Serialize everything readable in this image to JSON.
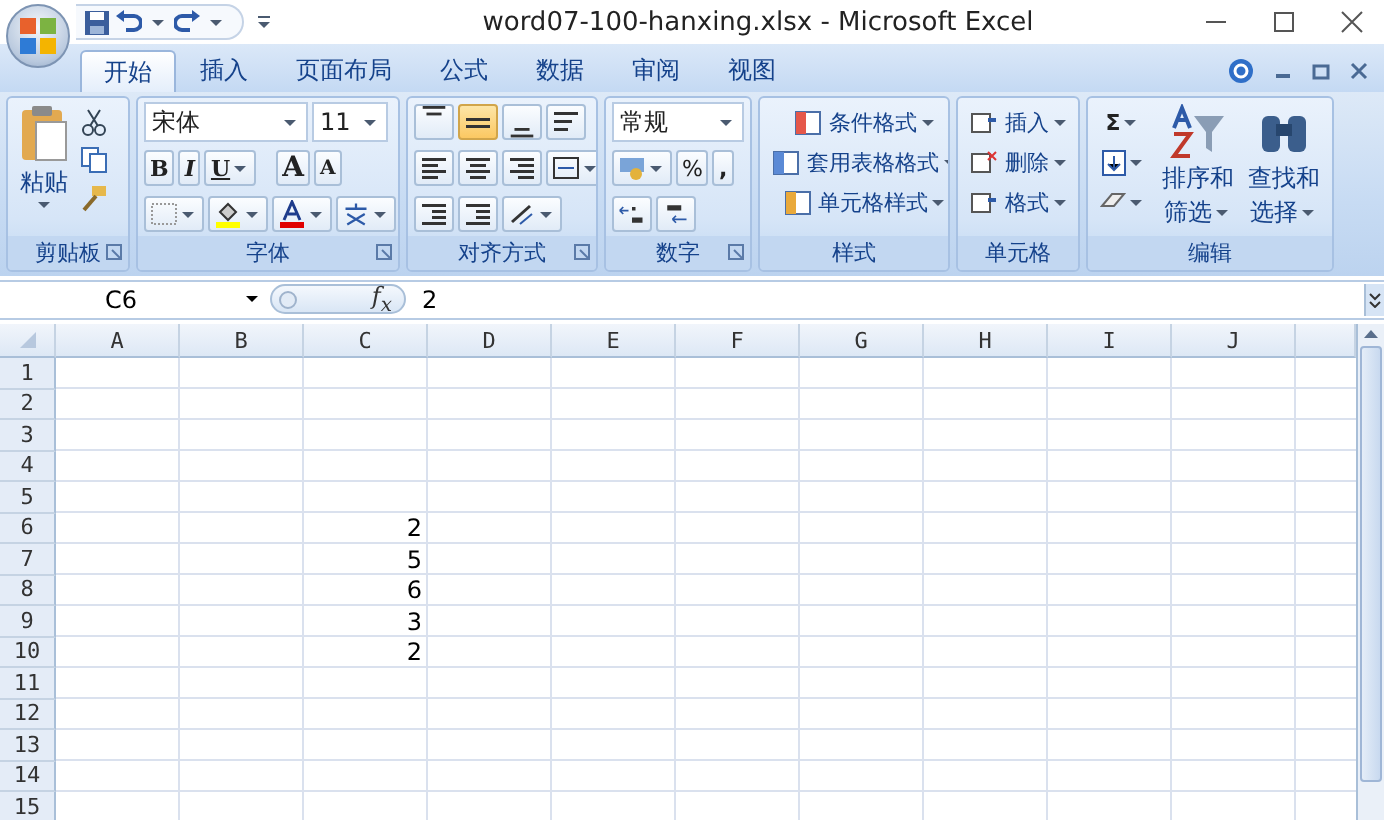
{
  "window": {
    "title": "word07-100-hanxing.xlsx - Microsoft Excel"
  },
  "tabs": [
    {
      "label": "开始",
      "selected": true
    },
    {
      "label": "插入",
      "selected": false
    },
    {
      "label": "页面布局",
      "selected": false
    },
    {
      "label": "公式",
      "selected": false
    },
    {
      "label": "数据",
      "selected": false
    },
    {
      "label": "审阅",
      "selected": false
    },
    {
      "label": "视图",
      "selected": false
    }
  ],
  "clipboard": {
    "paste": "粘贴",
    "label": "剪贴板"
  },
  "font": {
    "name": "宋体",
    "size": "11",
    "bold": "B",
    "italic": "I",
    "underline": "U",
    "grow": "A",
    "shrink": "A",
    "label": "字体"
  },
  "alignment": {
    "label": "对齐方式",
    "buttons": [
      {
        "kind": "top",
        "selected": false
      },
      {
        "kind": "middle",
        "selected": true
      },
      {
        "kind": "bottom",
        "selected": false
      },
      {
        "kind": "left",
        "selected": false
      },
      {
        "kind": "center",
        "selected": false
      },
      {
        "kind": "right",
        "selected": false
      }
    ]
  },
  "number": {
    "format": "常规",
    "percent": "%",
    "comma": ",",
    "label": "数字"
  },
  "styles": {
    "items": [
      "条件格式",
      "套用表格格式",
      "单元格样式"
    ],
    "label": "样式"
  },
  "cells": {
    "items": [
      "插入",
      "删除",
      "格式"
    ],
    "label": "单元格"
  },
  "editing": {
    "sum": "Σ",
    "sort": [
      "排序和",
      "筛选"
    ],
    "find": [
      "查找和",
      "选择"
    ],
    "label": "编辑"
  },
  "formula_bar": {
    "name_box": "C6",
    "fx": "f$_{x}$",
    "value": "2"
  },
  "sheet": {
    "columns": [
      "A",
      "B",
      "C",
      "D",
      "E",
      "F",
      "G",
      "H",
      "I",
      "J"
    ],
    "rows": [
      {
        "label": "1"
      },
      {
        "label": "2"
      },
      {
        "label": "3"
      },
      {
        "label": "4"
      },
      {
        "label": "5"
      },
      {
        "label": "6",
        "C": "2"
      },
      {
        "label": "7",
        "C": "5"
      },
      {
        "label": "8",
        "C": "6"
      },
      {
        "label": "9",
        "C": "3"
      },
      {
        "label": "10",
        "C": "2"
      },
      {
        "label": "11"
      },
      {
        "label": "12"
      },
      {
        "label": "13"
      },
      {
        "label": "14"
      },
      {
        "label": "15"
      }
    ]
  }
}
